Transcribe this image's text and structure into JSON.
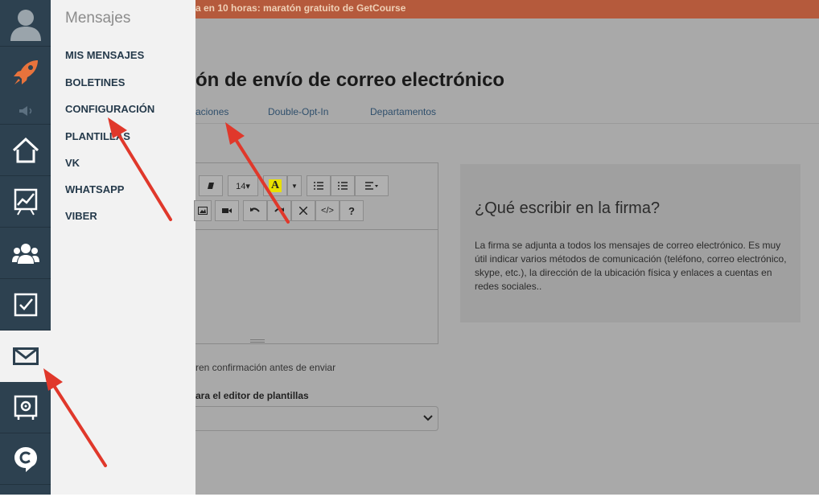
{
  "banner": {
    "text": "a en 10 horas: maratón gratuito de GetCourse"
  },
  "page": {
    "title": "ón de envío de correo electrónico"
  },
  "tabs": [
    {
      "label": "aciones"
    },
    {
      "label": "Double-Opt-In"
    },
    {
      "label": "Departamentos"
    }
  ],
  "flyout": {
    "title": "Mensajes",
    "items": [
      {
        "label": "MIS MENSAJES"
      },
      {
        "label": "BOLETINES"
      },
      {
        "label": "CONFIGURACIÓN"
      },
      {
        "label": "PLANTILLAS"
      },
      {
        "label": "VK"
      },
      {
        "label": "WHATSAPP"
      },
      {
        "label": "VIBER"
      }
    ]
  },
  "iconbar": {
    "items": [
      "avatar-icon",
      "rocket-icon",
      "speaker-icon",
      "home-icon",
      "chart-icon",
      "users-icon",
      "task-icon",
      "mail-icon",
      "safe-icon",
      "chat-icon"
    ],
    "active": "mail-icon"
  },
  "editor": {
    "font_size_label": "14▾",
    "help_label": "?",
    "code_label": "</>"
  },
  "info": {
    "title": "¿Qué escribir en la firma?",
    "body": "La firma se adjunta a todos los mensajes de correo electrónico. Es muy útil indicar varios métodos de comunicación (teléfono, correo electrónico, skype, etc.), la dirección de la ubicación física y enlaces a cuentas en redes sociales.."
  },
  "confirm": {
    "text": "ren confirmación antes de enviar"
  },
  "template_editor": {
    "label": "ara el editor de plantillas",
    "value": ""
  },
  "colors": {
    "sidebar": "#2d4150",
    "accent_rocket": "#e8733c",
    "banner": "#b55a3c",
    "annotation_arrow": "#e0382b"
  }
}
